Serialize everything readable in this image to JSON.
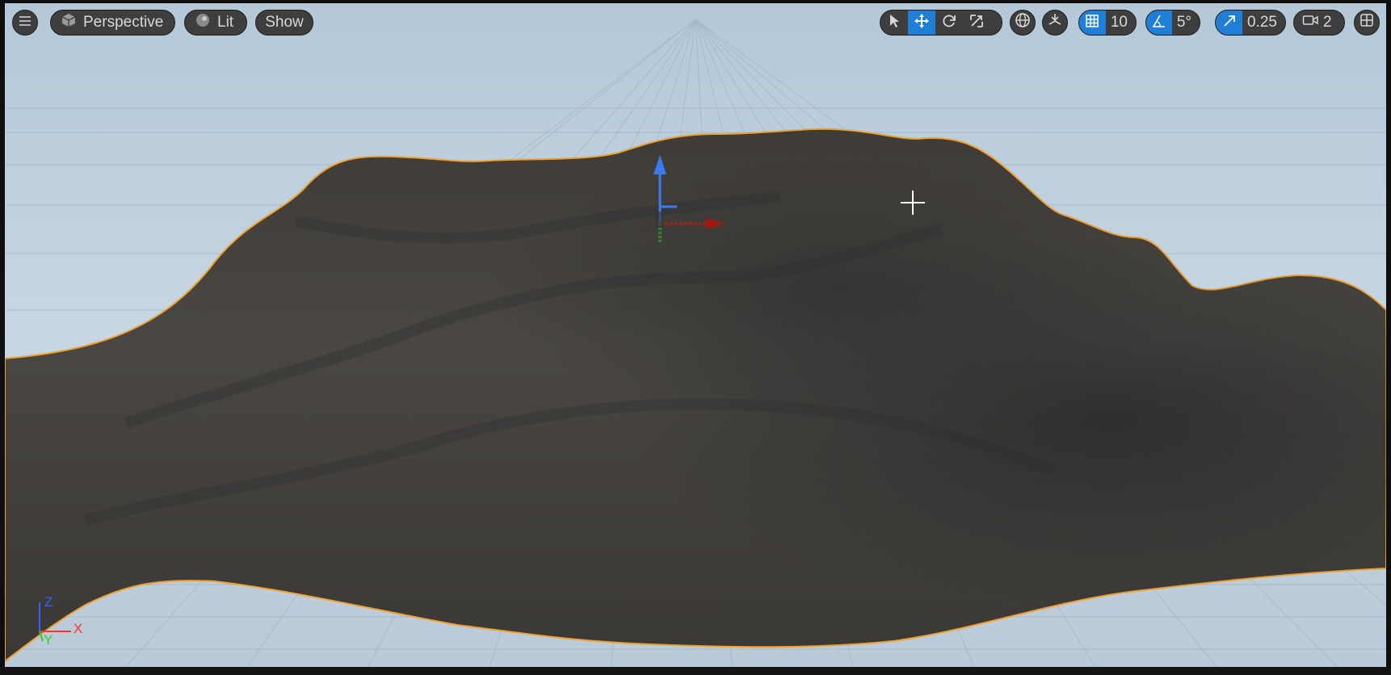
{
  "viewport": {
    "menu_icon": "hamburger-icon",
    "view_mode": {
      "label": "Perspective",
      "icon": "cube-icon"
    },
    "lighting_mode": {
      "label": "Lit",
      "icon": "sphere-icon"
    },
    "show_menu": {
      "label": "Show"
    },
    "transform_tools": [
      {
        "name": "select",
        "icon": "cursor-arrow-icon",
        "active": false
      },
      {
        "name": "translate",
        "icon": "move-arrows-icon",
        "active": true
      },
      {
        "name": "rotate",
        "icon": "rotate-icon",
        "active": false
      },
      {
        "name": "scale",
        "icon": "scale-icon",
        "active": false
      }
    ],
    "coordinate_system_icon": "globe-icon",
    "surface_snapping_icon": "surface-snap-icon",
    "grid_snap": {
      "icon": "grid-icon",
      "value": "10",
      "enabled": true
    },
    "rotation_snap": {
      "icon": "angle-icon",
      "value": "5°",
      "enabled": true
    },
    "scale_snap": {
      "icon": "scale-arrow-icon",
      "value": "0.25",
      "enabled": true
    },
    "camera_speed": {
      "icon": "camera-icon",
      "value": "2"
    },
    "layout_icon": "viewport-layout-icon",
    "accent_color": "#1f7fd6",
    "selection_outline_color": "#f0a030",
    "axis_indicator": {
      "z": "Z",
      "x": "X",
      "y": "Y"
    }
  }
}
